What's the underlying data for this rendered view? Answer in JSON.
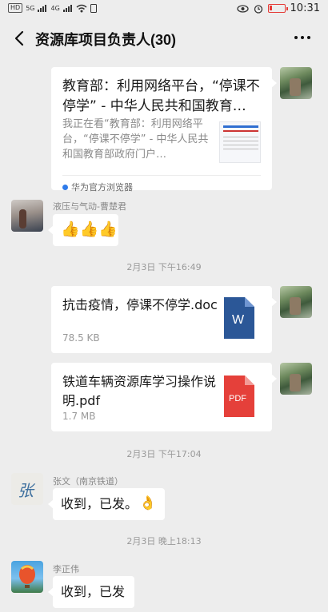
{
  "status_bar": {
    "tags": [
      "HD",
      "5G",
      "4G"
    ],
    "time": "10:31"
  },
  "header": {
    "title": "资源库项目负责人(30)"
  },
  "messages": {
    "link": {
      "title": "教育部：利用网络平台，“停课不停学” - 中华人民共和国教育…",
      "desc": "我正在看“教育部：利用网络平台，“停课不停学” - 中华人民共和国教育部政府门户…",
      "source": "华为官方浏览器"
    },
    "cao": {
      "sender": "液压与气动-曹楚君",
      "emoji": "👍👍👍"
    },
    "ts1": "2月3日 下午16:49",
    "file1": {
      "name": "抗击疫情，停课不停学.doc",
      "size": "78.5 KB",
      "icon_label": "W"
    },
    "file2": {
      "name": "铁道车辆资源库学习操作说明.pdf",
      "size": "1.7 MB",
      "icon_label": "PDF"
    },
    "ts2": "2月3日 下午17:04",
    "zhang": {
      "sender": "张文（南京铁道）",
      "text": "收到，已发。",
      "emoji": "👌",
      "avatar_text": "张"
    },
    "ts3": "2月3日 晚上18:13",
    "li": {
      "sender": "李正伟",
      "text": "收到，已发"
    }
  },
  "colors": {
    "background": "#ededed",
    "bubble": "#ffffff",
    "word_blue": "#2b5797",
    "pdf_red": "#e5403a"
  }
}
